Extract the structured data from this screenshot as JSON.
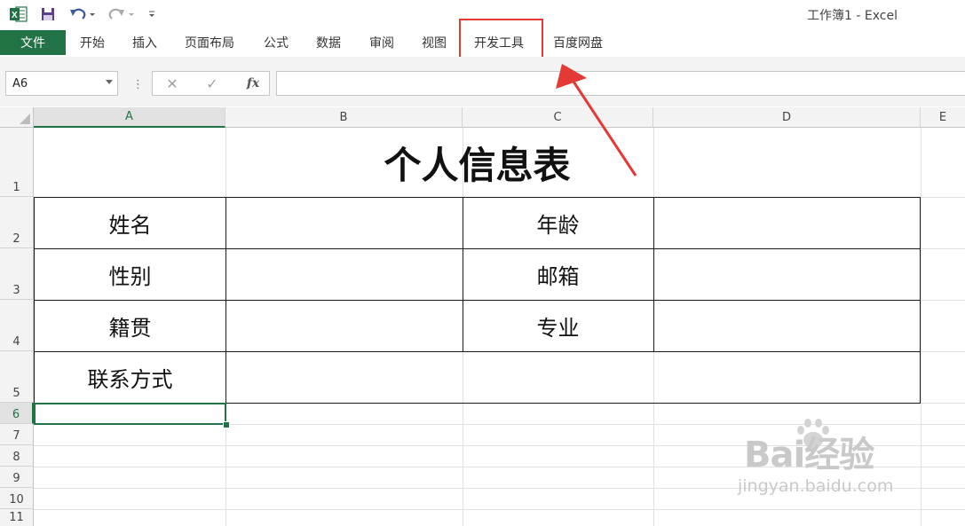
{
  "titlebar": {
    "app_icon": "excel-logo-icon",
    "window_title": "工作簿1 - Excel"
  },
  "ribbon": {
    "file_tab": "文件",
    "tabs": [
      "开始",
      "插入",
      "页面布局",
      "公式",
      "数据",
      "审阅",
      "视图",
      "开发工具",
      "百度网盘"
    ],
    "highlighted_tab": "开发工具"
  },
  "formula_bar": {
    "name_box": "A6",
    "fx_label": "fx",
    "formula": ""
  },
  "sheet": {
    "columns": [
      "A",
      "B",
      "C",
      "D",
      "E"
    ],
    "selected_column": "A",
    "rows": [
      "1",
      "2",
      "3",
      "4",
      "5",
      "6",
      "7",
      "8",
      "9",
      "10",
      "11"
    ],
    "selected_row": "6",
    "title": "个人信息表",
    "labels": {
      "name": "姓名",
      "age": "年龄",
      "gender": "性别",
      "email": "邮箱",
      "hometown": "籍贯",
      "major": "专业",
      "contact": "联系方式"
    }
  },
  "watermark": {
    "brand": "Bai经验",
    "url": "jingyan.baidu.com"
  },
  "colors": {
    "excel_green": "#217346",
    "highlight_red": "#e53935"
  }
}
